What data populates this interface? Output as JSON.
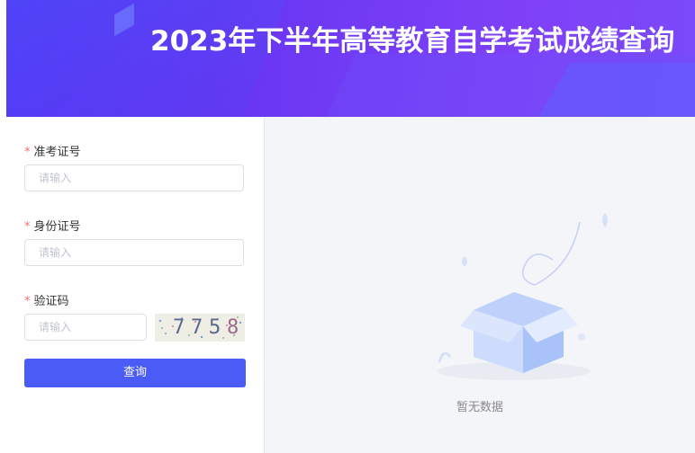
{
  "header": {
    "title": "2023年下半年高等教育自学考试成绩查询"
  },
  "form": {
    "ticket": {
      "label": "准考证号",
      "required_mark": "*",
      "placeholder": "请输入"
    },
    "id_card": {
      "label": "身份证号",
      "required_mark": "*",
      "placeholder": "请输入"
    },
    "captcha": {
      "label": "验证码",
      "required_mark": "*",
      "placeholder": "请输入",
      "image_text": "7758"
    },
    "submit_label": "查询"
  },
  "result": {
    "empty_text": "暂无数据"
  },
  "colors": {
    "accent": "#4a5cf5",
    "required": "#f56c6c",
    "banner": "#6a36f2"
  }
}
